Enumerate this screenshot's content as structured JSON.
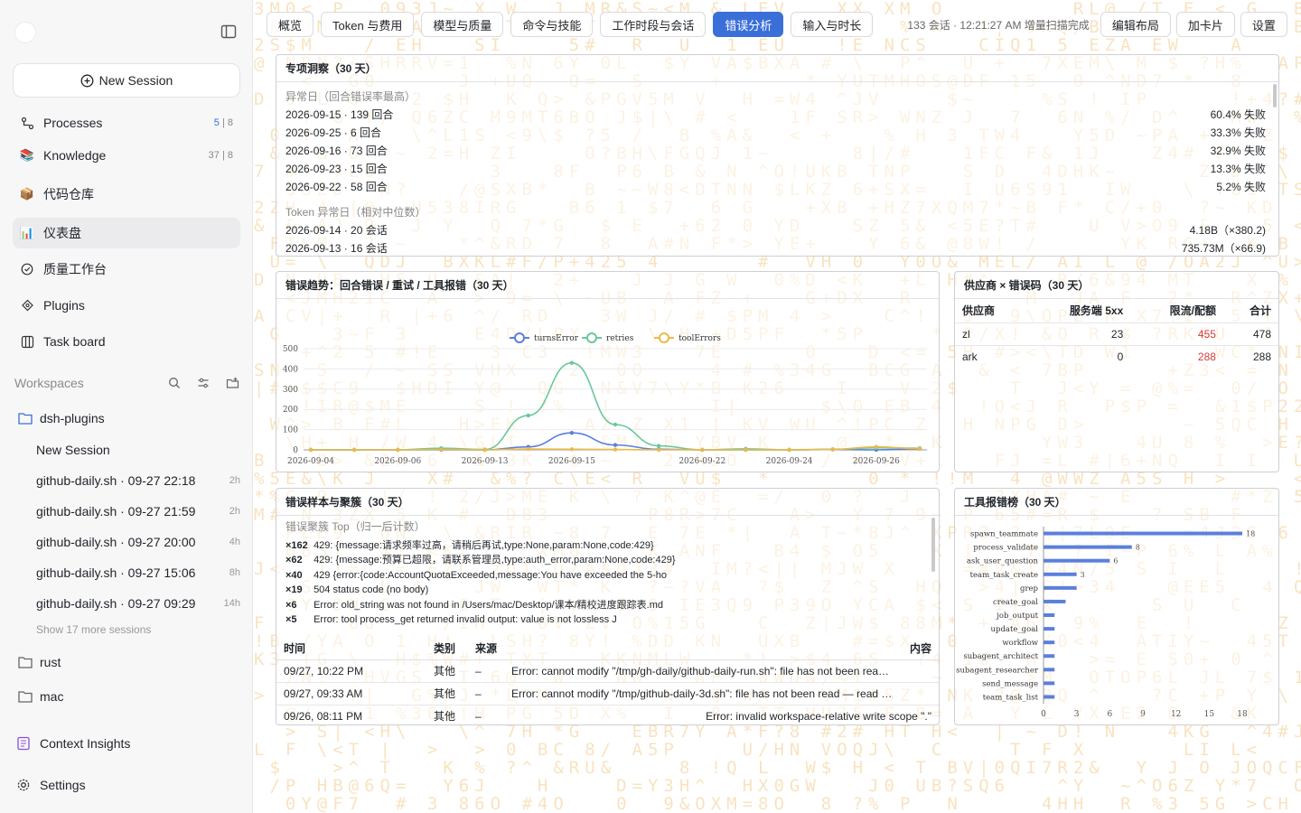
{
  "sidebar": {
    "new_session": "New Session",
    "processes": {
      "label": "Processes",
      "count_a": "5",
      "count_b": "| 8"
    },
    "knowledge": {
      "label": "Knowledge",
      "count": "37 | 8"
    },
    "repo": "代码仓库",
    "dashboard": "仪表盘",
    "quality": "质量工作台",
    "plugins": "Plugins",
    "taskboard": "Task board",
    "workspaces": "Workspaces",
    "folders": [
      "dsh-plugins",
      "rust",
      "mac"
    ],
    "sessions": [
      {
        "title": "New Session",
        "age": ""
      },
      {
        "title": "github-daily.sh · 09-27 22:18",
        "age": "2h"
      },
      {
        "title": "github-daily.sh · 09-27 21:59",
        "age": "2h"
      },
      {
        "title": "github-daily.sh · 09-27 20:00",
        "age": "4h"
      },
      {
        "title": "github-daily.sh · 09-27 15:06",
        "age": "8h"
      },
      {
        "title": "github-daily.sh · 09-27 09:29",
        "age": "14h"
      }
    ],
    "show_more": "Show 17 more sessions",
    "context_insights": "Context Insights",
    "settings": "Settings"
  },
  "tabs": [
    "概览",
    "Token 与费用",
    "模型与质量",
    "命令与技能",
    "工作时段与会话",
    "错误分析",
    "输入与时长"
  ],
  "active_tab": "错误分析",
  "status": "133 会话 · 12:21:27 AM 增量扫描完成",
  "actions": [
    "编辑布局",
    "加卡片",
    "设置"
  ],
  "insights": {
    "title": "专项洞察（30 天）",
    "sub1": "异常日（回合错误率最高）",
    "rows1": [
      {
        "label": "2026-09-15 · 139 回合",
        "value": "60.4% 失败"
      },
      {
        "label": "2026-09-25 · 6 回合",
        "value": "33.3% 失败"
      },
      {
        "label": "2026-09-16 · 73 回合",
        "value": "32.9% 失败"
      },
      {
        "label": "2026-09-23 · 15 回合",
        "value": "13.3% 失败"
      },
      {
        "label": "2026-09-22 · 58 回合",
        "value": "5.2% 失败"
      }
    ],
    "sub2": "Token 异常日（相对中位数）",
    "rows2": [
      {
        "label": "2026-09-14 · 20 会话",
        "value": "4.18B（×380.2)"
      },
      {
        "label": "2026-09-13 · 16 会话",
        "value": "735.73M（×66.9)"
      }
    ]
  },
  "trend": {
    "title": "错误趋势：回合错误 / 重试 / 工具报错（30 天）"
  },
  "provider": {
    "title": "供应商 × 错误码（30 天）",
    "headers": [
      "供应商",
      "服务端 5xx",
      "限流/配额",
      "合计"
    ],
    "rows": [
      {
        "name": "zl",
        "s5xx": "23",
        "quota": "455",
        "total": "478"
      },
      {
        "name": "ark",
        "s5xx": "0",
        "quota": "288",
        "total": "288"
      }
    ]
  },
  "errors": {
    "title": "错误样本与聚簇（30 天）",
    "sub": "错误聚簇 Top（归一后计数）",
    "clusters": [
      {
        "count": "×162",
        "text": "429: {message:请求频率过高，请稍后再试,type:None,param:None,code:429}"
      },
      {
        "count": "×62",
        "text": "429: {message:预算已超限，请联系管理员,type:auth_error,param:None,code:429}"
      },
      {
        "count": "×40",
        "text": "429 {error:{code:AccountQuotaExceeded,message:You have exceeded the 5-ho"
      },
      {
        "count": "×19",
        "text": "504 status code (no body)"
      },
      {
        "count": "×6",
        "text": "Error: old_string was not found in /Users/mac/Desktop/课本/精校进度跟踪表.md"
      },
      {
        "count": "×5",
        "text": "Error: tool process_get returned invalid output: value is not lossless J"
      }
    ],
    "headers": [
      "时间",
      "类别",
      "来源",
      "内容"
    ],
    "samples": [
      {
        "time": "09/27, 10:22 PM",
        "cat": "其他",
        "src": "–",
        "content": "Error: cannot modify \"/tmp/gh-daily/github-daily-run.sh\": file has not been rea…"
      },
      {
        "time": "09/27, 09:33 AM",
        "cat": "其他",
        "src": "–",
        "content": "Error: cannot modify \"/tmp/github-daily-3d.sh\": file has not been read — read …"
      },
      {
        "time": "09/26, 08:11 PM",
        "cat": "其他",
        "src": "–",
        "content": "Error: invalid workspace-relative write scope \".\""
      }
    ]
  },
  "tools": {
    "title": "工具报错榜（30 天）"
  },
  "chart_data": [
    {
      "type": "line",
      "title": "错误趋势：回合错误 / 重试 / 工具报错（30 天）",
      "x": [
        "2026-09-04",
        "2026-09-05",
        "2026-09-06",
        "2026-09-07",
        "2026-09-13",
        "2026-09-14",
        "2026-09-15",
        "2026-09-16",
        "2026-09-18",
        "2026-09-22",
        "2026-09-23",
        "2026-09-24",
        "2026-09-25",
        "2026-09-26",
        "2026-09-27"
      ],
      "x_ticks": [
        "2026-09-04",
        "2026-09-06",
        "2026-09-13",
        "2026-09-15",
        "2026-09-22",
        "2026-09-24",
        "2026-09-26"
      ],
      "ylim": [
        0,
        500
      ],
      "y_ticks": [
        0,
        100,
        200,
        300,
        400,
        500
      ],
      "series": [
        {
          "name": "turnsError",
          "color": "#5b7fdc",
          "values": [
            0,
            0,
            0,
            0,
            0,
            15,
            84,
            24,
            3,
            0,
            0,
            0,
            2,
            0,
            5
          ]
        },
        {
          "name": "retries",
          "color": "#66c99a",
          "values": [
            0,
            0,
            0,
            8,
            2,
            170,
            430,
            125,
            20,
            0,
            5,
            0,
            3,
            10,
            8
          ]
        },
        {
          "name": "toolErrors",
          "color": "#eab94a",
          "values": [
            0,
            0,
            0,
            2,
            0,
            4,
            3,
            2,
            0,
            1,
            0,
            1,
            2,
            15,
            6
          ]
        }
      ]
    },
    {
      "type": "bar",
      "title": "工具报错榜（30 天）",
      "categories": [
        "spawn_teammate",
        "process_validate",
        "ask_user_question",
        "team_task_create",
        "grep",
        "create_goal",
        "job_output",
        "update_goal",
        "workflow",
        "subagent_architect",
        "subagent_researcher",
        "send_message",
        "team_task_list"
      ],
      "values": [
        18,
        8,
        6,
        3,
        3,
        2,
        1,
        1,
        1,
        1,
        1,
        1,
        1
      ],
      "color": "#5b7fdc",
      "x_ticks": [
        0,
        3,
        6,
        9,
        12,
        15,
        18
      ],
      "xlim": [
        0,
        18
      ]
    }
  ]
}
